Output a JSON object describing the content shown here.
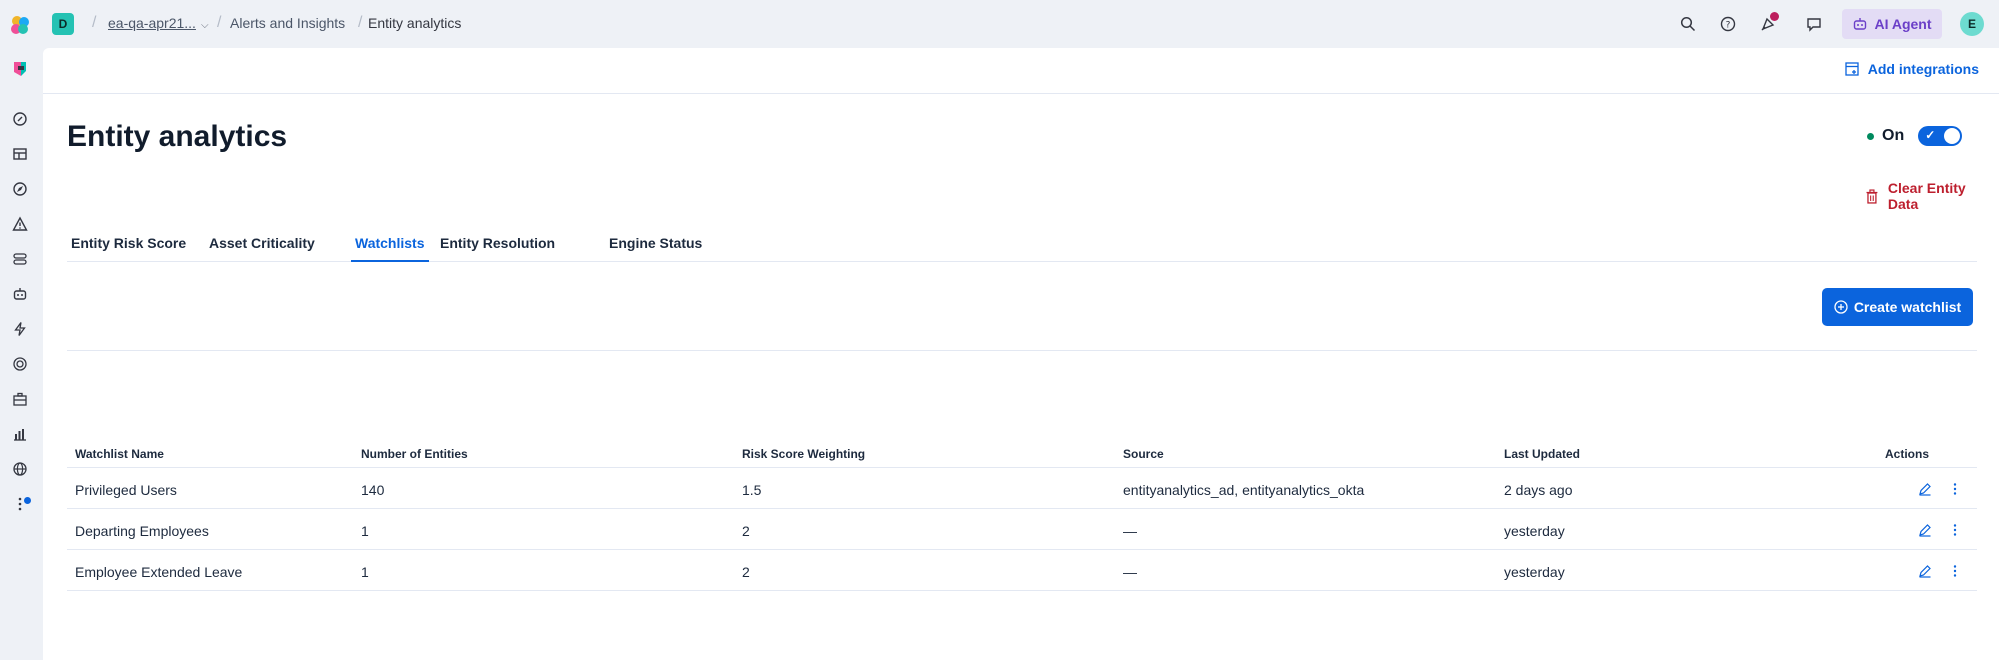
{
  "topbar": {
    "space_initial": "D",
    "breadcrumbs": [
      "ea-qa-apr21...",
      "Alerts and Insights",
      "Entity analytics"
    ],
    "ai_agent_label": "AI Agent",
    "avatar_initial": "E"
  },
  "header": {
    "add_integrations_label": "Add integrations"
  },
  "page": {
    "title": "Entity analytics",
    "status_label": "On",
    "clear_data_label": "Clear Entity Data"
  },
  "tabs": [
    {
      "label": "Entity Risk Score",
      "active": false
    },
    {
      "label": "Asset Criticality",
      "active": false
    },
    {
      "label": "Watchlists",
      "active": true
    },
    {
      "label": "Entity Resolution",
      "active": false
    },
    {
      "label": "Engine Status",
      "active": false
    }
  ],
  "create_watchlist_label": "Create watchlist",
  "table": {
    "columns": [
      "Watchlist Name",
      "Number of Entities",
      "Risk Score Weighting",
      "Source",
      "Last Updated",
      "Actions"
    ],
    "rows": [
      {
        "name": "Privileged Users",
        "entities": "140",
        "weighting": "1.5",
        "source": "entityanalytics_ad, entityanalytics_okta",
        "updated": "2 days ago"
      },
      {
        "name": "Departing Employees",
        "entities": "1",
        "weighting": "2",
        "source": "—",
        "updated": "yesterday"
      },
      {
        "name": "Employee Extended Leave",
        "entities": "1",
        "weighting": "2",
        "source": "—",
        "updated": "yesterday"
      }
    ]
  },
  "colors": {
    "primary": "#0b64dd",
    "danger": "#bd1f2e",
    "success": "#008a5e",
    "ai_agent_bg": "#e3dcf5"
  },
  "icons": {
    "sidebar": [
      "security-logo-icon",
      "rocket-icon",
      "dashboard-icon",
      "compass-icon",
      "alert-icon",
      "rules-icon",
      "robot-icon",
      "bolt-icon",
      "target-icon",
      "briefcase-icon",
      "chart-icon",
      "globe-icon",
      "more-icon"
    ]
  }
}
